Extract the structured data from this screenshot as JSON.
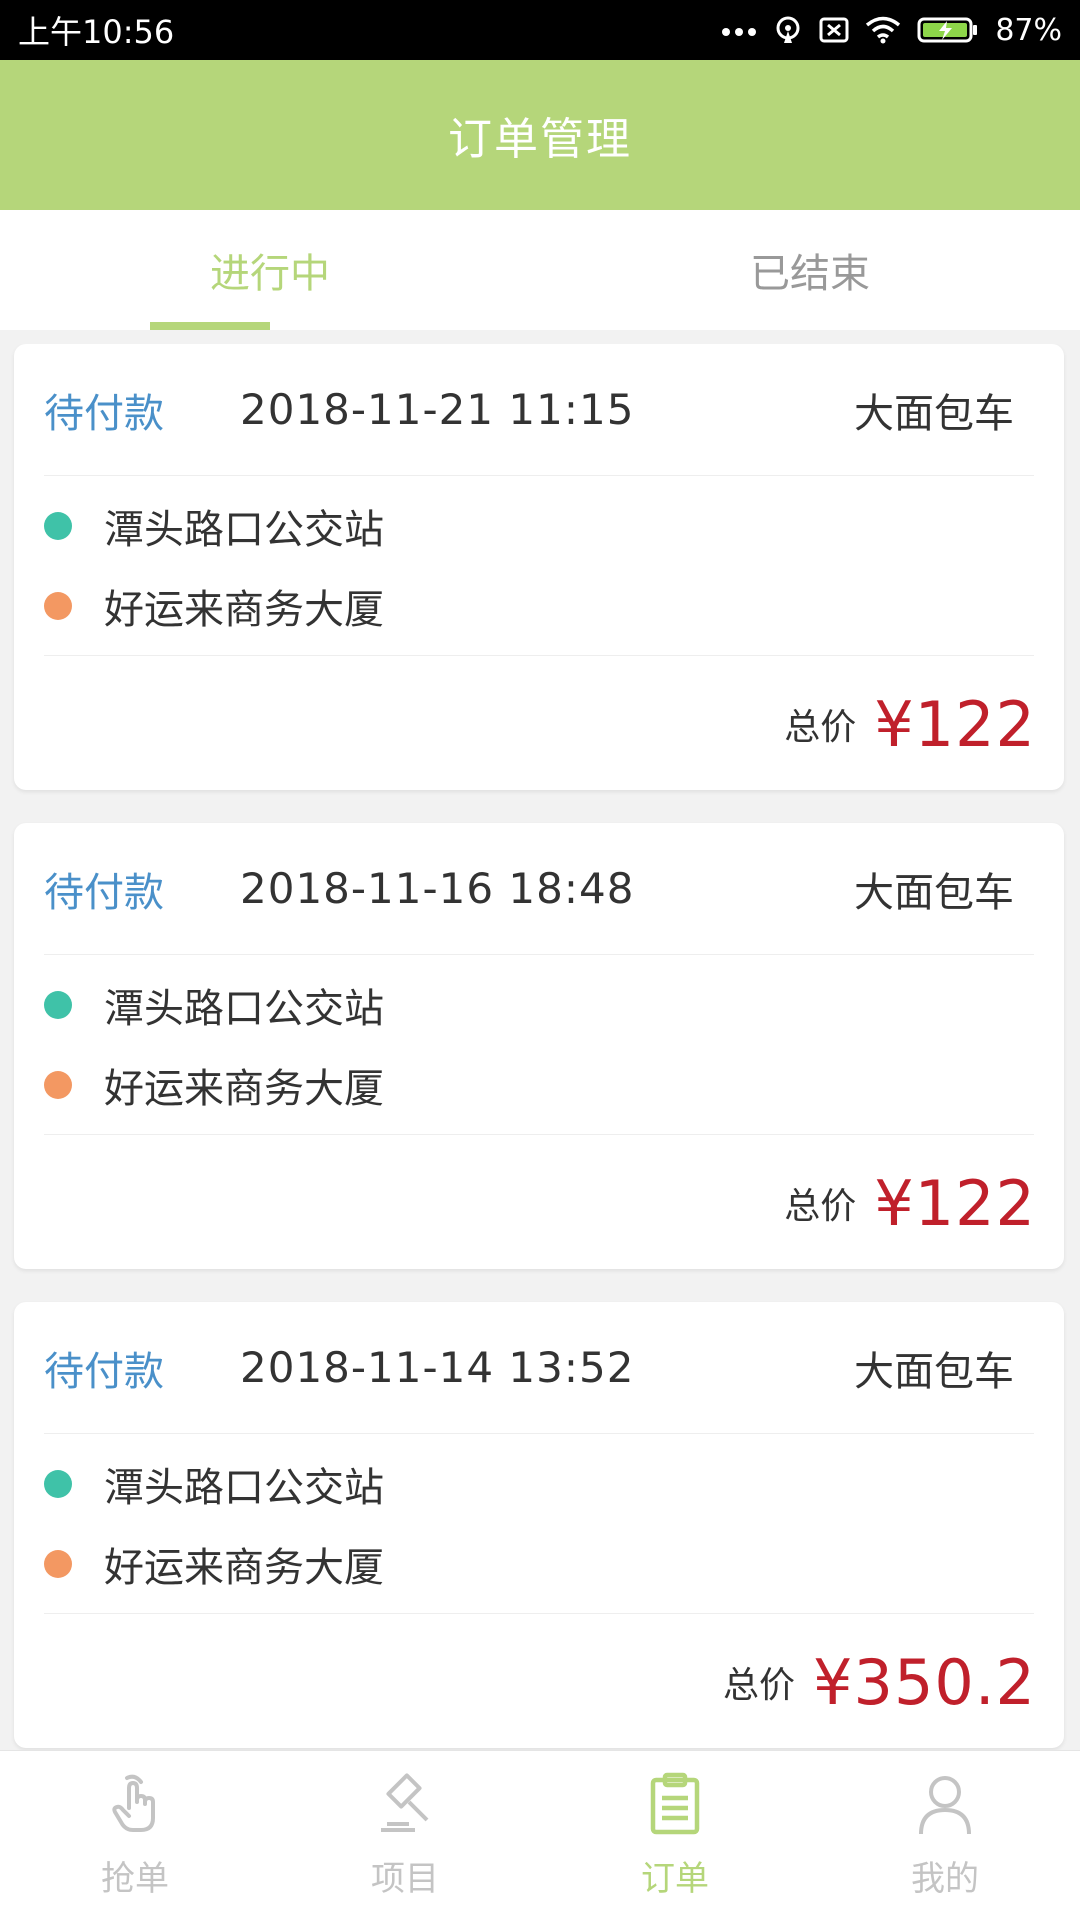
{
  "statusbar": {
    "time": "上午10:56",
    "battery": "87%"
  },
  "header": {
    "title": "订单管理"
  },
  "tabs": [
    {
      "label": "进行中",
      "active": true
    },
    {
      "label": "已结束",
      "active": false
    }
  ],
  "orders": [
    {
      "status": "待付款",
      "datetime": "2018-11-21 11:15",
      "type": "大面包车",
      "from": "潭头路口公交站",
      "to": "好运来商务大厦",
      "total_label": "总价",
      "price": "¥122"
    },
    {
      "status": "待付款",
      "datetime": "2018-11-16 18:48",
      "type": "大面包车",
      "from": "潭头路口公交站",
      "to": "好运来商务大厦",
      "total_label": "总价",
      "price": "¥122"
    },
    {
      "status": "待付款",
      "datetime": "2018-11-14 13:52",
      "type": "大面包车",
      "from": "潭头路口公交站",
      "to": "好运来商务大厦",
      "total_label": "总价",
      "price": "¥350.2"
    }
  ],
  "bottom_nav": [
    {
      "label": "抢单",
      "icon": "hand-tap-icon",
      "active": false
    },
    {
      "label": "项目",
      "icon": "gavel-icon",
      "active": false
    },
    {
      "label": "订单",
      "icon": "clipboard-icon",
      "active": true
    },
    {
      "label": "我的",
      "icon": "user-icon",
      "active": false
    }
  ],
  "colors": {
    "accent": "#b5d67a",
    "status_blue": "#4a90c9",
    "price_red": "#c0202b",
    "start_dot": "#3fc2a8",
    "end_dot": "#f39862"
  }
}
